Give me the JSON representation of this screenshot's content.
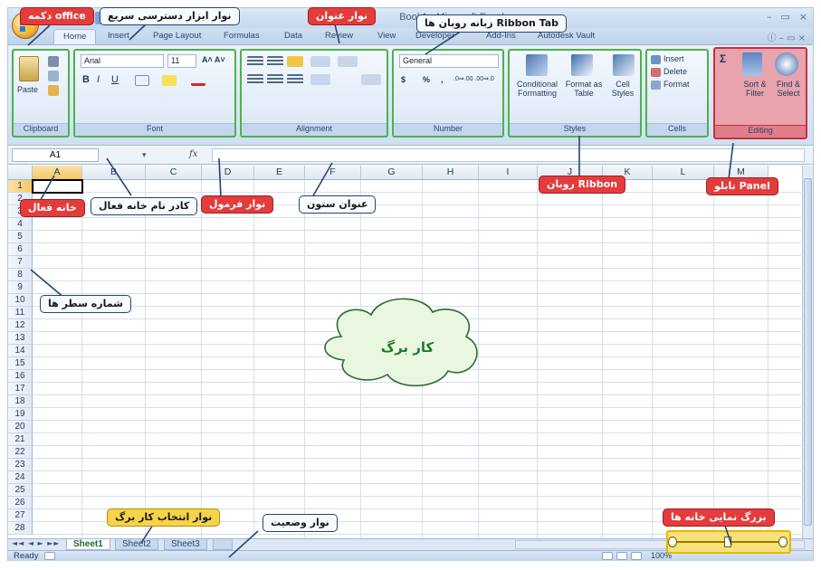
{
  "app": {
    "title": "Book1 - Microsoft Excel",
    "minimize": "–",
    "restore": "▭",
    "close": "×",
    "help": "ⓘ – ▭ ×"
  },
  "tabs": [
    "Home",
    "Insert",
    "Page Layout",
    "Formulas",
    "Data",
    "Review",
    "View",
    "Developer",
    "Add-Ins",
    "Autodesk Vault"
  ],
  "ribbon": {
    "clipboard": {
      "label": "Clipboard",
      "paste": "Paste"
    },
    "font": {
      "label": "Font",
      "name": "Arial",
      "size": "11",
      "bold": "B",
      "italic": "I",
      "underline": "U",
      "grow": "A˄ A˅"
    },
    "alignment": {
      "label": "Alignment"
    },
    "number": {
      "label": "Number",
      "format": "General",
      "currency": "$",
      "percent": "%",
      "comma": ",",
      "inc_dec": ".0⇒.00 .00⇒.0"
    },
    "styles": {
      "label": "Styles",
      "conditional": "Conditional Formatting",
      "format_table": "Format as Table",
      "cell_styles": "Cell Styles"
    },
    "cells": {
      "label": "Cells",
      "insert": "Insert",
      "delete": "Delete",
      "format": "Format"
    },
    "editing": {
      "label": "Editing",
      "sum": "Σ",
      "sort": "Sort & Filter",
      "find": "Find & Select"
    }
  },
  "formula_bar": {
    "namebox": "A1",
    "fx": "fx",
    "content": ""
  },
  "columns": [
    "A",
    "B",
    "C",
    "D",
    "E",
    "F",
    "G",
    "H",
    "I",
    "J",
    "K",
    "L",
    "M"
  ],
  "rows": [
    "1",
    "2",
    "3",
    "4",
    "5",
    "6",
    "7",
    "8",
    "9",
    "10",
    "11",
    "12",
    "13",
    "14",
    "15",
    "16",
    "17",
    "18",
    "19",
    "20",
    "21",
    "22",
    "23",
    "24",
    "25",
    "26",
    "27",
    "28"
  ],
  "sheets": {
    "nav": "◄◄ ◄ ► ►►",
    "tabs": [
      "Sheet1",
      "Sheet2",
      "Sheet3"
    ],
    "active": "Sheet1"
  },
  "status": {
    "text": "Ready",
    "zoom": "100%"
  },
  "annotations": {
    "office_button": "دکمه office",
    "quick_access": "نوار ابزار دسترسی سریع",
    "title_bar": "نوار عنوان",
    "ribbon_tab": "زبانه روبان ها Ribbon Tab",
    "active_cell": "خانه فعال",
    "name_box": "کادر نام خانه فعال",
    "formula_bar": "نوار فرمول",
    "column_header": "عنوان ستون",
    "ribbon": "روبان Ribbon",
    "panel": "تابلو Panel",
    "row_numbers": "شماره سطر ها",
    "worksheet": "کار برگ",
    "sheet_selector": "نوار انتخاب کار برگ",
    "status_bar": "نوار وضعیت",
    "zoom": "بزرگ نمایی خانه ها"
  },
  "colors": {
    "accent": "#1e395b",
    "ribbon_bg": "#dbe7f5",
    "annotation_red": "#e43c3c",
    "panel_red": "#c9303f",
    "panel_green": "#4db24d",
    "zoom_yellow": "#f6e27a"
  }
}
